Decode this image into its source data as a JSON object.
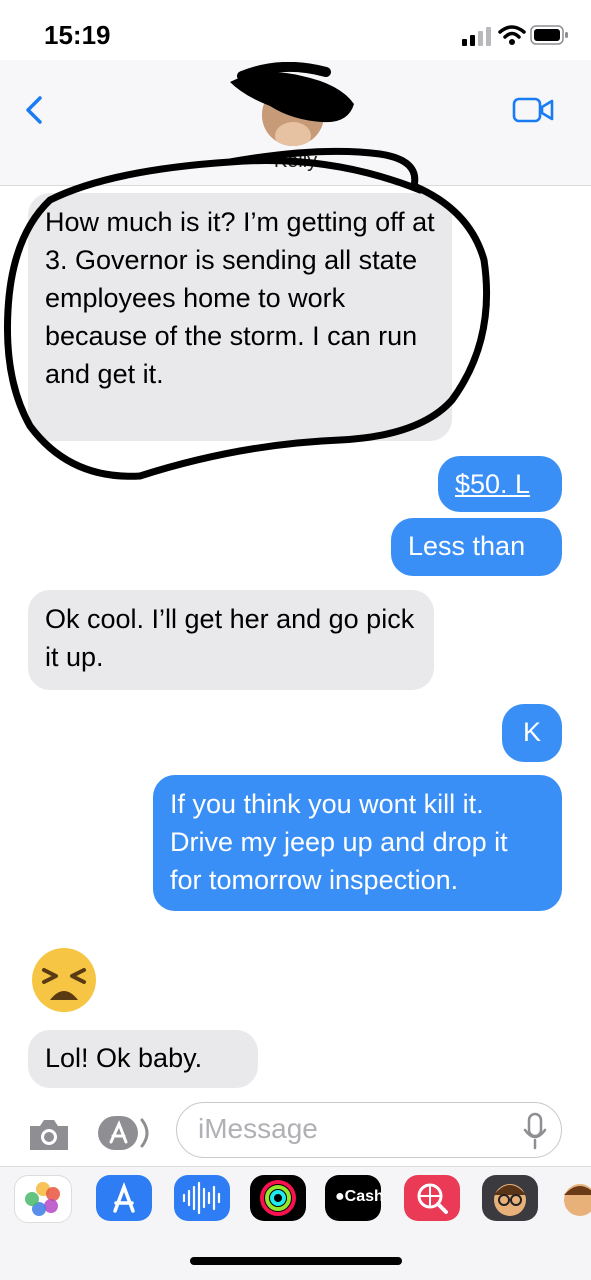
{
  "status_bar": {
    "time": "15:19"
  },
  "header": {
    "contact_name": "Kelly"
  },
  "messages": [
    {
      "direction": "incoming",
      "text": "How much is it?  I’m getting off at 3. Governor is sending all state employees home to work because of the storm. I can run and get it."
    },
    {
      "direction": "outgoing",
      "text": "$50. L"
    },
    {
      "direction": "outgoing",
      "text": "Less than"
    },
    {
      "direction": "incoming",
      "text": "Ok cool. I’ll get her and go pick it up."
    },
    {
      "direction": "outgoing",
      "text": "K"
    },
    {
      "direction": "outgoing",
      "text": "If you think you wont kill it. Drive my jeep up and drop it for tomorrow inspection."
    },
    {
      "direction": "incoming",
      "text": "😫"
    },
    {
      "direction": "incoming",
      "text": "Lol!  Ok baby."
    }
  ],
  "input": {
    "placeholder": "iMessage"
  },
  "app_drawer": {
    "apps": [
      "photos-icon",
      "app-store-icon",
      "audio-message-icon",
      "activity-icon",
      "apple-cash-icon",
      "web-images-icon",
      "memoji-icon",
      "memoji-stickers-icon"
    ],
    "cash_label": "Cash"
  },
  "colors": {
    "outgoing_bubble": "#3a8ff6",
    "incoming_bubble": "#e9e9eb",
    "accent": "#1a7cf5"
  }
}
